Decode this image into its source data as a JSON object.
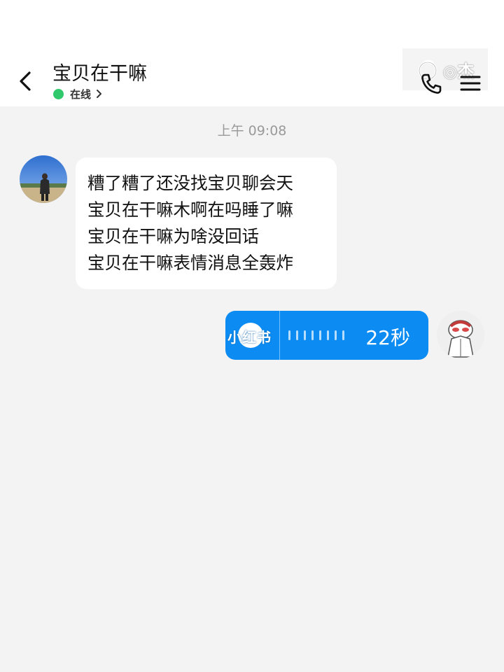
{
  "header": {
    "back_icon": "chevron-left-icon",
    "contact_name": "宝贝在干嘛",
    "status_text": "在线",
    "status_color": "#2fc86a",
    "watermark_text": "◎杰",
    "call_icon": "phone-icon",
    "menu_icon": "hamburger-menu-icon"
  },
  "chat": {
    "timestamp": "上午 09:08",
    "incoming_message": {
      "lines": [
        "糟了糟了还没找宝贝聊会天",
        "宝贝在干嘛木啊在吗睡了嘛",
        "宝贝在干嘛为啥没回话",
        "宝贝在干嘛表情消息全轰炸"
      ]
    },
    "outgoing_voice": {
      "overlay_text": "小红书",
      "duration": "22秒",
      "bubble_color": "#0c8cf3"
    }
  }
}
